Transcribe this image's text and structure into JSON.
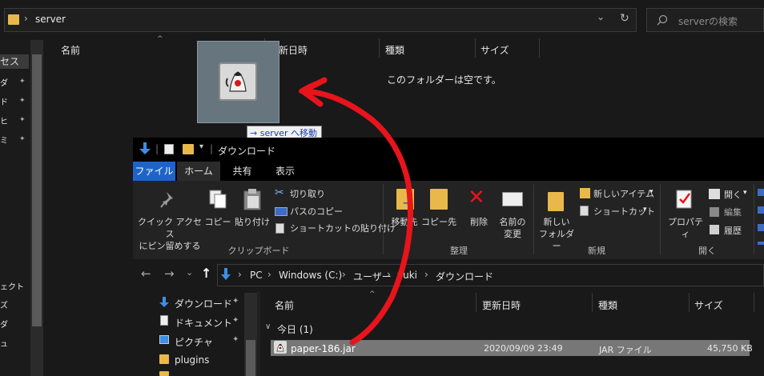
{
  "back_window": {
    "address_text": "server",
    "search_placeholder": "serverの検索",
    "chevron": "›",
    "dropdown_glyph": "⌄",
    "refresh_glyph": "↻",
    "columns": [
      "名前",
      "更新日時",
      "種類",
      "サイズ"
    ],
    "empty_message": "このフォルダーは空です。",
    "sidebar_fragments": [
      "セス",
      "ダ",
      "ド",
      "ヒ",
      "ミ",
      "ェクト",
      "ズ",
      "ダ",
      "ュ"
    ]
  },
  "drag": {
    "icon": "java-jar-icon",
    "tooltip_arrow": "→",
    "tooltip_text": "server へ移動"
  },
  "front_window": {
    "title": "ダウンロード",
    "tabs": [
      "ファイル",
      "ホーム",
      "共有",
      "表示"
    ],
    "ribbon": {
      "clipboard": {
        "pin": "クイック アクセス\nにピン留めする",
        "copy": "コピー",
        "paste": "貼り付け",
        "cut": "切り取り",
        "copy_path": "パスのコピー",
        "paste_shortcut": "ショートカットの貼り付け",
        "group": "クリップボード"
      },
      "organize": {
        "move_to": "移動先",
        "copy_to": "コピー先",
        "delete": "削除",
        "rename": "名前の\n変更",
        "group": "整理"
      },
      "new": {
        "new_folder": "新しい\nフォルダー",
        "new_item": "新しいアイテム",
        "shortcut": "ショートカット",
        "group": "新規"
      },
      "open": {
        "properties": "プロパティ",
        "open": "開く",
        "edit": "編集",
        "history": "履歴",
        "group": "開く"
      }
    },
    "breadcrumb": [
      "PC",
      "Windows (C:)",
      "ユーザー",
      "yuki",
      "ダウンロード"
    ],
    "nav_items": [
      {
        "label": "ダウンロード",
        "icon": "download-arrow-icon"
      },
      {
        "label": "ドキュメント",
        "icon": "document-icon"
      },
      {
        "label": "ピクチャ",
        "icon": "pictures-icon"
      },
      {
        "label": "plugins",
        "icon": "folder-icon"
      }
    ],
    "columns": [
      "名前",
      "更新日時",
      "種類",
      "サイズ"
    ],
    "group_header": "今日 (1)",
    "files": [
      {
        "name": "paper-186.jar",
        "modified": "2020/09/09 23:49",
        "type": "JAR ファイル",
        "size": "45,750 KB"
      }
    ]
  },
  "colors": {
    "accent_blue": "#1e64c8",
    "annotation_red": "#e8141c",
    "folder_yellow": "#e8b84a"
  }
}
